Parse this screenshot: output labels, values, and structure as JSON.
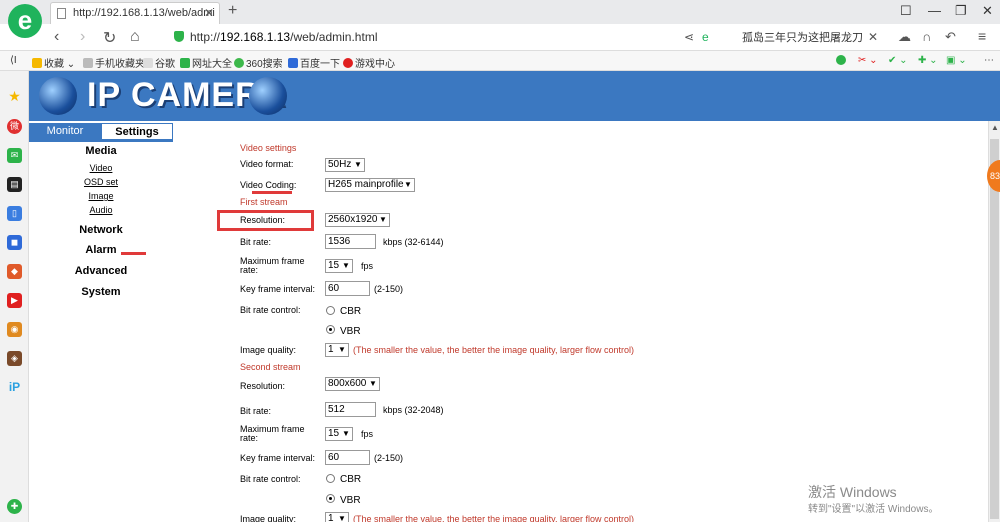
{
  "browser": {
    "tab_title": "http://192.168.1.13/web/admi",
    "url_prefix": "http://",
    "url_host": "192.168.1.13",
    "url_path": "/web/admin.html",
    "search_text": "孤岛三年只为这把屠龙刀",
    "bookmarks": [
      "收藏",
      "手机收藏夹",
      "谷歌",
      "网址大全",
      "360搜索",
      "百度一下",
      "游戏中心"
    ],
    "sidebar_badge": "83"
  },
  "header": {
    "brand": "IP CAMERA"
  },
  "menu": {
    "tabs": [
      "Monitor",
      "Settings"
    ],
    "media": "Media",
    "media_links": [
      "Video",
      "OSD set",
      "Image",
      "Audio"
    ],
    "network": "Network",
    "alarm": "Alarm",
    "advanced": "Advanced",
    "system": "System"
  },
  "video": {
    "title": "Video settings",
    "format_label": "Video format:",
    "format_value": "50Hz",
    "coding_label": "Video Coding:",
    "coding_value": "H265 mainprofile",
    "first_stream": "First stream",
    "res_label": "Resolution:",
    "res_value": "2560x1920",
    "bitrate_label": "Bit rate:",
    "bitrate_value": "1536",
    "bitrate_hint": "kbps (32-6144)",
    "fps_label": "Maximum frame",
    "fps_label2": "rate:",
    "fps_value": "15",
    "fps_unit": "fps",
    "kf_label": "Key frame interval:",
    "kf_value": "60",
    "kf_hint": "(2-150)",
    "brc_label": "Bit rate control:",
    "cbr": "CBR",
    "vbr": "VBR",
    "iq_label": "Image quality:",
    "iq_value": "1",
    "iq_hint": "(The smaller the value, the better the image quality, larger flow control)",
    "second_stream": "Second stream",
    "res2_value": "800x600",
    "bitrate2_value": "512",
    "bitrate2_hint": "kbps (32-2048)",
    "fps2_value": "15",
    "kf2_value": "60",
    "iq2_label": "Image quality:",
    "iq2_value": "1"
  },
  "watermark": {
    "line1": "激活 Windows",
    "line2": "转到\"设置\"以激活 Windows。"
  }
}
